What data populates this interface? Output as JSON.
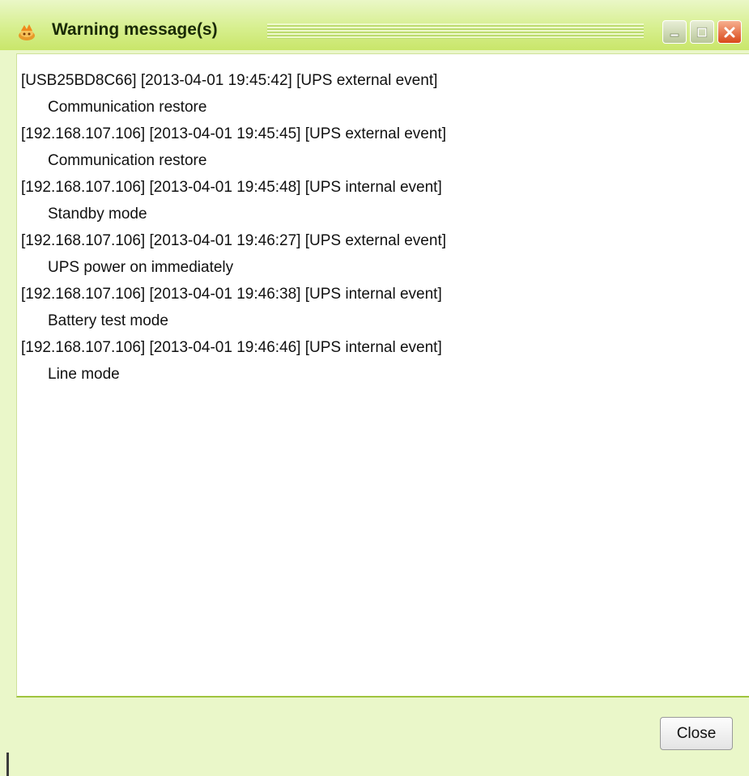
{
  "window": {
    "title": "Warning message(s)",
    "title_icon": "ups-warning-icon",
    "controls": [
      "minimize-icon",
      "maximize-icon",
      "close-icon"
    ]
  },
  "messages": [
    {
      "header": "[USB25BD8C66] [2013-04-01 19:45:42] [UPS external event]",
      "detail": "Communication restore"
    },
    {
      "header": "[192.168.107.106] [2013-04-01 19:45:45] [UPS external event]",
      "detail": "Communication restore"
    },
    {
      "header": "[192.168.107.106] [2013-04-01 19:45:48] [UPS internal event]",
      "detail": "Standby mode"
    },
    {
      "header": "[192.168.107.106] [2013-04-01 19:46:27] [UPS external event]",
      "detail": "UPS power on immediately"
    },
    {
      "header": "[192.168.107.106] [2013-04-01 19:46:38] [UPS internal event]",
      "detail": "Battery test mode"
    },
    {
      "header": "[192.168.107.106] [2013-04-01 19:46:46] [UPS internal event]",
      "detail": "Line mode"
    }
  ],
  "footer": {
    "close_label": "Close"
  },
  "colors": {
    "window_bg": "#eaf7c9",
    "titlebar": "#c9e66a",
    "close_button_red": "#d9481a"
  }
}
